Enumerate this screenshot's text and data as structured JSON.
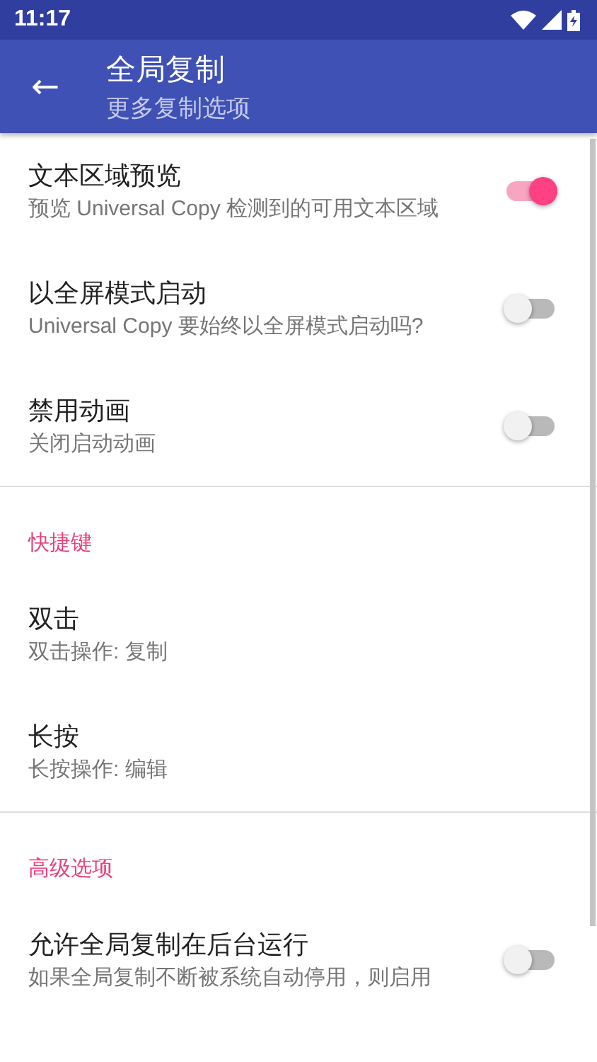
{
  "status_bar": {
    "time": "11:17"
  },
  "app_bar": {
    "back": "←",
    "title": "全局复制",
    "subtitle": "更多复制选项"
  },
  "sections": [
    {
      "items": [
        {
          "kind": "switch",
          "title": "文本区域预览",
          "summary": "预览 Universal Copy 检测到的可用文本区域",
          "on": true
        },
        {
          "kind": "switch",
          "title": "以全屏模式启动",
          "summary": "Universal Copy 要始终以全屏模式启动吗?",
          "on": false
        },
        {
          "kind": "switch",
          "title": "禁用动画",
          "summary": "关闭启动动画",
          "on": false
        }
      ]
    },
    {
      "header": "快捷键",
      "items": [
        {
          "kind": "plain",
          "title": "双击",
          "summary": "双击操作: 复制"
        },
        {
          "kind": "plain",
          "title": "长按",
          "summary": "长按操作: 编辑"
        }
      ]
    },
    {
      "header": "高级选项",
      "items": [
        {
          "kind": "switch",
          "title": "允许全局复制在后台运行",
          "summary": "如果全局复制不断被系统自动停用，则启用",
          "on": false
        }
      ]
    }
  ]
}
